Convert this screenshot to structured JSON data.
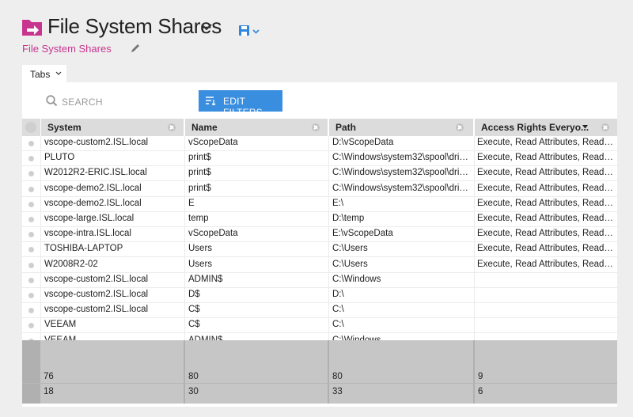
{
  "header": {
    "title": "File System Shares",
    "subtitle": "File System Shares"
  },
  "tabs": {
    "label": "Tabs"
  },
  "toolbar": {
    "search_placeholder": "SEARCH",
    "edit_filters_label": "EDIT FILTERS"
  },
  "table": {
    "columns": [
      "System",
      "Name",
      "Path",
      "Access Rights Everyo..."
    ],
    "rows": [
      [
        "vscope-custom2.ISL.local",
        "vScopeData",
        "D:\\vScopeData",
        "Execute, Read Attributes, Read D..."
      ],
      [
        "PLUTO",
        "print$",
        "C:\\Windows\\system32\\spool\\drive...",
        "Execute, Read Attributes, Read D..."
      ],
      [
        "W2012R2-ERIC.ISL.local",
        "print$",
        "C:\\Windows\\system32\\spool\\drive...",
        "Execute, Read Attributes, Read D..."
      ],
      [
        "vscope-demo2.ISL.local",
        "print$",
        "C:\\Windows\\system32\\spool\\drive...",
        "Execute, Read Attributes, Read D..."
      ],
      [
        "vscope-demo2.ISL.local",
        "E",
        "E:\\",
        "Execute, Read Attributes, Read D..."
      ],
      [
        "vscope-large.ISL.local",
        "temp",
        "D:\\temp",
        "Execute, Read Attributes, Read D..."
      ],
      [
        "vscope-intra.ISL.local",
        "vScopeData",
        "E:\\vScopeData",
        "Execute, Read Attributes, Read D..."
      ],
      [
        "TOSHIBA-LAPTOP",
        "Users",
        "C:\\Users",
        "Execute, Read Attributes, Read D..."
      ],
      [
        "W2008R2-02",
        "Users",
        "C:\\Users",
        "Execute, Read Attributes, Read D..."
      ],
      [
        "vscope-custom2.ISL.local",
        "ADMIN$",
        "C:\\Windows",
        ""
      ],
      [
        "vscope-custom2.ISL.local",
        "D$",
        "D:\\",
        ""
      ],
      [
        "vscope-custom2.ISL.local",
        "C$",
        "C:\\",
        ""
      ],
      [
        "VEEAM",
        "C$",
        "C:\\",
        ""
      ],
      [
        "VEEAM",
        "ADMIN$",
        "C:\\Windows",
        ""
      ]
    ],
    "summary": {
      "row1": [
        "76",
        "80",
        "80",
        "9"
      ],
      "row2": [
        "18",
        "30",
        "33",
        "6"
      ]
    }
  },
  "colors": {
    "accent": "#c8358f",
    "button": "#3a8ee0",
    "save_icon": "#2e86de"
  },
  "icons": [
    "folder-share-icon",
    "chevron-down-icon",
    "save-icon",
    "pencil-icon",
    "search-icon",
    "filter-icon",
    "sort-desc-icon",
    "close-icon"
  ]
}
